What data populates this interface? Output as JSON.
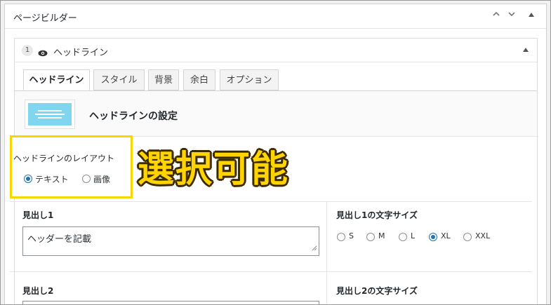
{
  "metabox": {
    "title": "ページビルダー",
    "controls": {
      "up_icon": "chevron-up-icon",
      "down_icon": "chevron-down-icon",
      "toggle_icon": "triangle-up-icon"
    }
  },
  "block": {
    "number": "1",
    "visibility_icon": "eye-icon",
    "title": "ヘッドライン",
    "toggle_icon": "triangle-up-icon"
  },
  "tabs": [
    {
      "label": "ヘッドライン",
      "active": true
    },
    {
      "label": "スタイル",
      "active": false
    },
    {
      "label": "背景",
      "active": false
    },
    {
      "label": "余白",
      "active": false
    },
    {
      "label": "オプション",
      "active": false
    }
  ],
  "section": {
    "title": "ヘッドラインの設定"
  },
  "layout": {
    "label": "ヘッドラインのレイアウト",
    "options": [
      {
        "label": "テキスト",
        "checked": true
      },
      {
        "label": "画像",
        "checked": false
      }
    ]
  },
  "annotation": {
    "text": "選択可能",
    "highlight_color": "#f5d800"
  },
  "heading1": {
    "label": "見出し1",
    "value": "ヘッダーを記載"
  },
  "heading1_size": {
    "label": "見出し1の文字サイズ",
    "options": [
      {
        "label": "S",
        "checked": false
      },
      {
        "label": "M",
        "checked": false
      },
      {
        "label": "L",
        "checked": false
      },
      {
        "label": "XL",
        "checked": true
      },
      {
        "label": "XXL",
        "checked": false
      }
    ]
  },
  "heading2": {
    "label": "見出し2"
  },
  "heading2_size": {
    "label": "見出し2の文字サイズ"
  },
  "colors": {
    "accent": "#2271b1",
    "thumbnail": "#7fd6ee"
  }
}
